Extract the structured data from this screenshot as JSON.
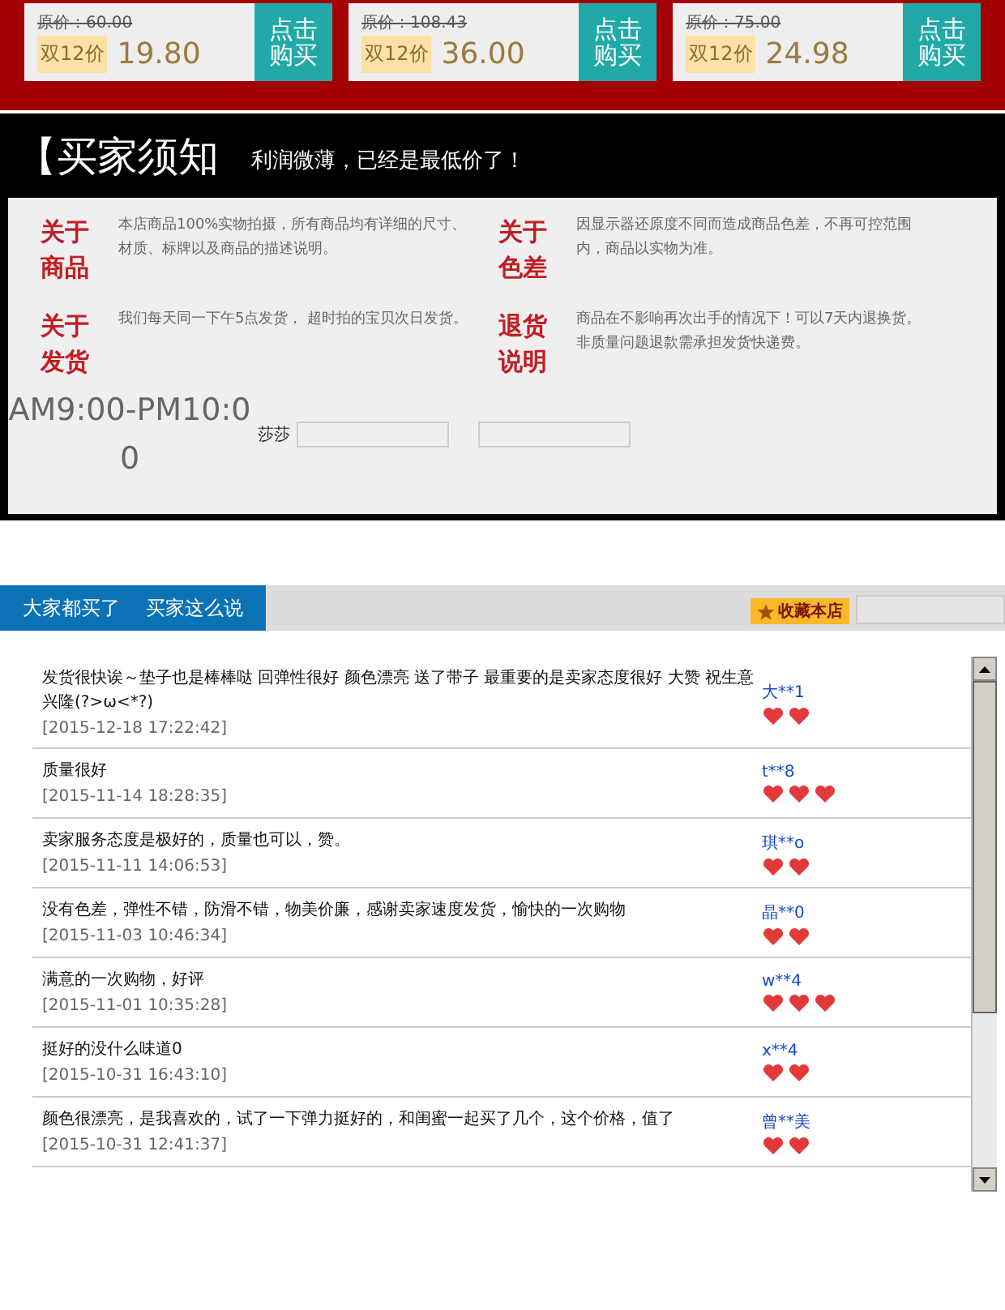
{
  "products": [
    {
      "original_price": "原价：60.00",
      "promo_label": "双12价",
      "price": "19.80",
      "buy": "点击购买"
    },
    {
      "original_price": "原价：108.43",
      "promo_label": "双12价",
      "price": "36.00",
      "buy": "点击购买"
    },
    {
      "original_price": "原价：75.00",
      "promo_label": "双12价",
      "price": "24.98",
      "buy": "点击购买"
    }
  ],
  "notice": {
    "title": "【买家须知",
    "subtitle": "利润微薄，已经是最低价了！",
    "items": [
      {
        "heading": "关于商品",
        "text": "本店商品100%实物拍摄，所有商品均有详细的尺寸、材质、标牌以及商品的描述说明。"
      },
      {
        "heading": "关于色差",
        "text": "因显示器还原度不同而造成商品色差，不再可控范围内，商品以实物为准。"
      },
      {
        "heading": "关于发货",
        "text": "我们每天同一下午5点发货， 超时拍的宝贝次日发货。"
      },
      {
        "heading": "退货说明",
        "text": "商品在不影响再次出手的情况下！可以7天内退换货。非质量问题退款需承担发货快递费。"
      }
    ],
    "hours": "AM9:00-PM10:00",
    "staff": "莎莎"
  },
  "reviews_bar": {
    "tabs": [
      {
        "label": "大家都买了"
      },
      {
        "label": "买家这么说"
      }
    ],
    "favorite": "收藏本店"
  },
  "reviews": [
    {
      "text": "发货很快诶～垫子也是棒棒哒 回弹性很好 颜色漂亮 送了带子 最重要的是卖家态度很好 大赞 祝生意兴隆(?>ω<*?)",
      "date": "[2015-12-18 17:22:42]",
      "user": "大**1",
      "credit": [
        {
          "kind": "heart"
        },
        {
          "kind": "heart"
        }
      ]
    },
    {
      "text": "质量很好",
      "date": "[2015-11-14 18:28:35]",
      "user": "t**8",
      "credit": [
        {
          "kind": "heart"
        },
        {
          "kind": "heart"
        },
        {
          "kind": "heart"
        }
      ]
    },
    {
      "text": "卖家服务态度是极好的，质量也可以，赞。",
      "date": "[2015-11-11 14:06:53]",
      "user": "琪**o",
      "credit": [
        {
          "kind": "heart"
        },
        {
          "kind": "heart"
        }
      ]
    },
    {
      "text": "没有色差，弹性不错，防滑不错，物美价廉，感谢卖家速度发货，愉快的一次购物",
      "date": "[2015-11-03 10:46:34]",
      "user": "晶**0",
      "credit": [
        {
          "kind": "heart"
        },
        {
          "kind": "heart"
        }
      ]
    },
    {
      "text": "满意的一次购物，好评",
      "date": "[2015-11-01 10:35:28]",
      "user": "w**4",
      "credit": [
        {
          "kind": "heart"
        },
        {
          "kind": "heart"
        },
        {
          "kind": "heart"
        }
      ]
    },
    {
      "text": "挺好的没什么味道0",
      "date": "[2015-10-31 16:43:10]",
      "user": "x**4",
      "credit": [
        {
          "kind": "heart"
        },
        {
          "kind": "heart"
        }
      ]
    },
    {
      "text": "颜色很漂亮，是我喜欢的，试了一下弹力挺好的，和闺蜜一起买了几个，这个价格，值了",
      "date": "[2015-10-31 12:41:37]",
      "user": "曾**美",
      "credit": [
        {
          "kind": "heart"
        },
        {
          "kind": "heart"
        }
      ]
    }
  ]
}
